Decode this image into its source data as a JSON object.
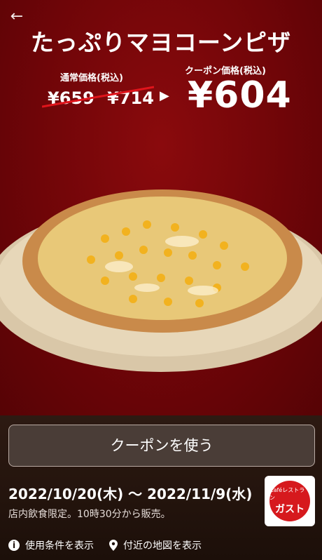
{
  "header": {
    "back_icon": "arrow-left-icon"
  },
  "hero": {
    "title": "たっぷりマヨコーンピザ",
    "regular_label": "通常価格(税込)",
    "regular_prices": [
      "¥659",
      "¥714"
    ],
    "coupon_label": "クーポン価格(税込)",
    "coupon_price": "¥604",
    "arrow": "▶"
  },
  "coupon": {
    "use_button": "クーポンを使う",
    "period": "2022/10/20(木) 〜 2022/11/9(水)",
    "note": "店内飲食限定。10時30分から販売。"
  },
  "brand": {
    "logo_small": "Caféレストラン",
    "logo_main": "ガスト",
    "accent": "#d6191d"
  },
  "links": {
    "conditions": "使用条件を表示",
    "map": "付近の地図を表示"
  }
}
